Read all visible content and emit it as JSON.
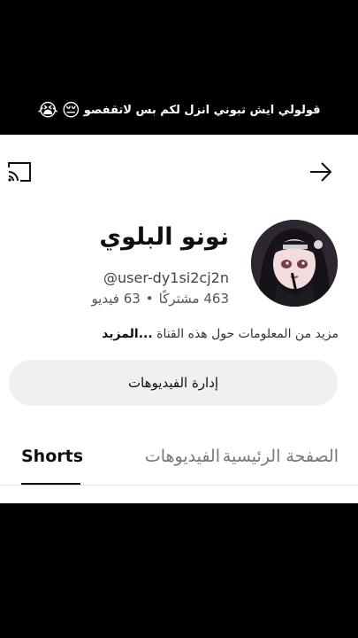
{
  "caption": {
    "text": "قولولي ايش تبوني انزل لكم بس لاتقفصو",
    "emojis": [
      "😔",
      "😭"
    ]
  },
  "topbar": {
    "cast_icon": "cast-icon",
    "forward_icon": "arrow-right-icon"
  },
  "channel": {
    "name": "نونو البلوي",
    "handle": "@user-dy1si2cj2n",
    "subscribers": "463 مشتركًا",
    "separator": "•",
    "videos": "63 فيديو",
    "description": "مزيد من المعلومات حول هذه القناة",
    "more_label": "...المزيد"
  },
  "manage_button": {
    "label": "إدارة الفيديوهات"
  },
  "tabs": [
    {
      "label": "الصفحة الرئيسية",
      "active": false
    },
    {
      "label": "الفيديوهات",
      "active": false
    },
    {
      "label": "Shorts",
      "active": true
    }
  ],
  "colors": {
    "background": "#000000",
    "panel": "#ffffff",
    "text_primary": "#0f0f0f",
    "text_secondary": "#555555",
    "button_bg": "#f0f0f0"
  }
}
